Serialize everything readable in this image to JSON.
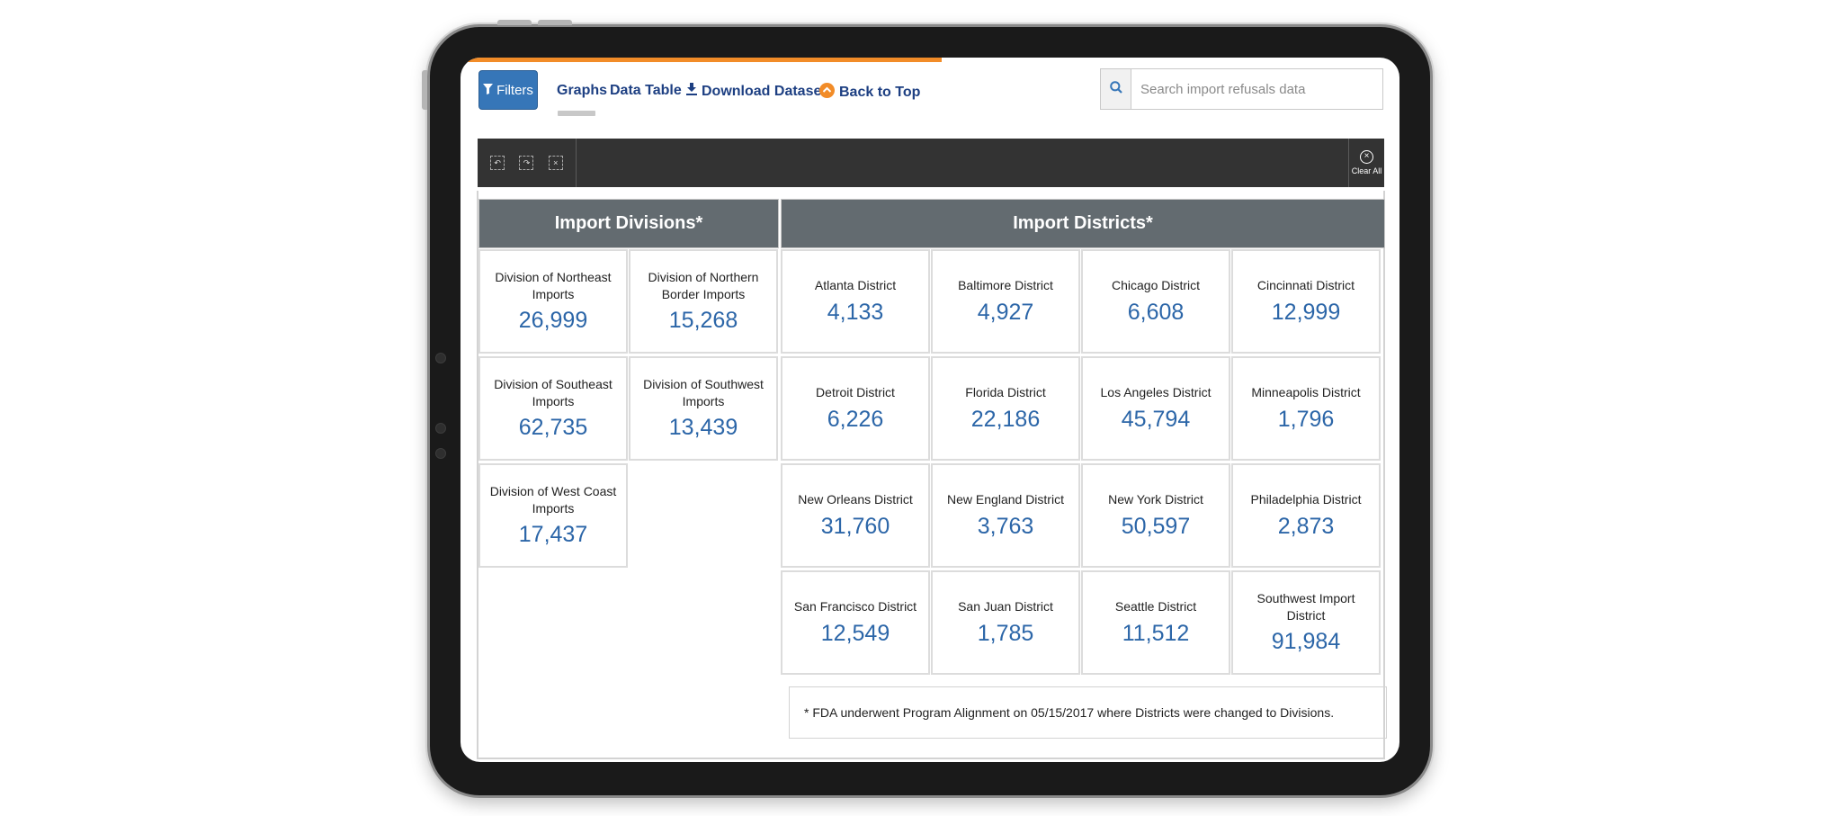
{
  "toolbar": {
    "filters_label": "Filters",
    "tabs": [
      {
        "label": "Graphs"
      },
      {
        "label": "Data Table"
      },
      {
        "label": "Download Dataset"
      },
      {
        "label": "Back to Top"
      }
    ]
  },
  "search": {
    "placeholder": "Search import refusals data"
  },
  "selection_bar": {
    "clear_all_label": "Clear All"
  },
  "divisions": {
    "header": "Import Divisions*",
    "items": [
      {
        "label": "Division of Northeast Imports",
        "value": "26,999"
      },
      {
        "label": "Division of Northern Border Imports",
        "value": "15,268"
      },
      {
        "label": "Division of Southeast Imports",
        "value": "62,735"
      },
      {
        "label": "Division of Southwest Imports",
        "value": "13,439"
      },
      {
        "label": "Division of West Coast Imports",
        "value": "17,437"
      }
    ]
  },
  "districts": {
    "header": "Import Districts*",
    "items": [
      {
        "label": "Atlanta District",
        "value": "4,133"
      },
      {
        "label": "Baltimore District",
        "value": "4,927"
      },
      {
        "label": "Chicago District",
        "value": "6,608"
      },
      {
        "label": "Cincinnati District",
        "value": "12,999"
      },
      {
        "label": "Detroit District",
        "value": "6,226"
      },
      {
        "label": "Florida District",
        "value": "22,186"
      },
      {
        "label": "Los Angeles District",
        "value": "45,794"
      },
      {
        "label": "Minneapolis District",
        "value": "1,796"
      },
      {
        "label": "New Orleans District",
        "value": "31,760"
      },
      {
        "label": "New England District",
        "value": "3,763"
      },
      {
        "label": "New York District",
        "value": "50,597"
      },
      {
        "label": "Philadelphia District",
        "value": "2,873"
      },
      {
        "label": "San Francisco District",
        "value": "12,549"
      },
      {
        "label": "San Juan District",
        "value": "1,785"
      },
      {
        "label": "Seattle District",
        "value": "11,512"
      },
      {
        "label": "Southwest Import District",
        "value": "91,984"
      }
    ]
  },
  "footnote": "* FDA underwent Program Alignment on 05/15/2017 where Districts were changed to Divisions.",
  "colors": {
    "accent_orange": "#f28c28",
    "filters_button": "#3676b8",
    "nav_link": "#1d3f82",
    "header_bg": "#636b70",
    "value_text": "#2c66a8",
    "toolbar_bg": "#333333"
  }
}
